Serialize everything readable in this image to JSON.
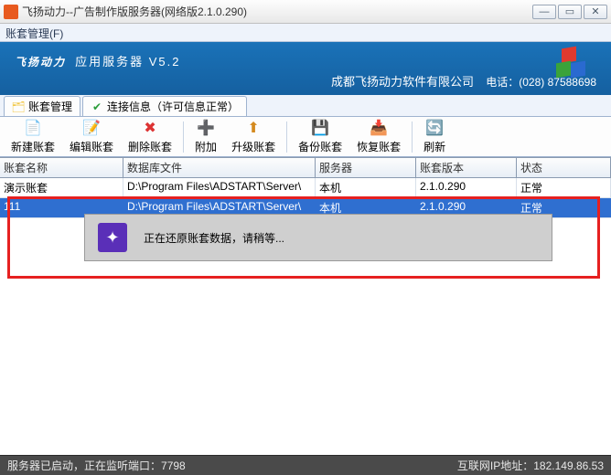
{
  "window": {
    "title": "飞扬动力--广告制作版服务器(网络版2.1.0.290)"
  },
  "menubar": {
    "account_mgmt": "账套管理(F)"
  },
  "banner": {
    "brand": "飞扬动力",
    "brand_sub": "应用服务器 V5.2",
    "company": "成都飞扬动力软件有限公司",
    "phone_label": "电话：",
    "phone": "(028) 87588698"
  },
  "tabs": {
    "manage": "账套管理",
    "conn": "连接信息（许可信息正常）"
  },
  "toolbar": {
    "new": "新建账套",
    "edit": "编辑账套",
    "delete": "删除账套",
    "attach": "附加",
    "upgrade": "升级账套",
    "backup": "备份账套",
    "restore": "恢复账套",
    "refresh": "刷新"
  },
  "grid": {
    "headers": {
      "name": "账套名称",
      "dbfile": "数据库文件",
      "server": "服务器",
      "version": "账套版本",
      "status": "状态"
    },
    "rows": [
      {
        "name": "演示账套",
        "dbfile": "D:\\Program Files\\ADSTART\\Server\\",
        "server": "本机",
        "version": "2.1.0.290",
        "status": "正常"
      },
      {
        "name": "111",
        "dbfile": "D:\\Program Files\\ADSTART\\Server\\",
        "server": "本机",
        "version": "2.1.0.290",
        "status": "正常"
      }
    ]
  },
  "dialog": {
    "text": "正在还原账套数据，请稍等..."
  },
  "status": {
    "left_a": "服务器已启动，",
    "left_b": "正在监听端口",
    "left_c": "：7798",
    "right_a": "互联网IP地址：",
    "right_b": "182.149.86.53"
  }
}
